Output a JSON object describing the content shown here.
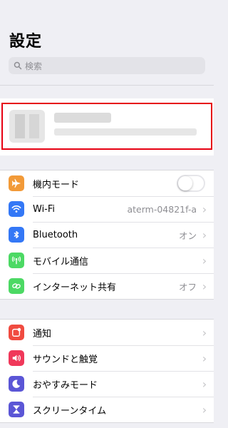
{
  "header": {
    "title": "設定"
  },
  "search": {
    "placeholder": "検索",
    "icon": "magnifying-glass-icon"
  },
  "profile": {
    "highlight_color": "#e60012"
  },
  "group1": {
    "items": [
      {
        "label": "機内モード",
        "icon": "airplane-icon",
        "color": "#f29a38",
        "toggle_on": false
      },
      {
        "label": "Wi-Fi",
        "value": "aterm-04821f-a",
        "icon": "wifi-icon",
        "color": "#3478f6"
      },
      {
        "label": "Bluetooth",
        "value": "オン",
        "icon": "bluetooth-icon",
        "color": "#3478f6"
      },
      {
        "label": "モバイル通信",
        "icon": "antenna-icon",
        "color": "#4cd964"
      },
      {
        "label": "インターネット共有",
        "value": "オフ",
        "icon": "link-icon",
        "color": "#4cd964"
      }
    ]
  },
  "group2": {
    "items": [
      {
        "label": "通知",
        "icon": "notifications-icon",
        "color": "#f04b40"
      },
      {
        "label": "サウンドと触覚",
        "icon": "speaker-icon",
        "color": "#f0385a"
      },
      {
        "label": "おやすみモード",
        "icon": "moon-icon",
        "color": "#5b56d6"
      },
      {
        "label": "スクリーンタイム",
        "icon": "hourglass-icon",
        "color": "#5b56d6"
      }
    ]
  }
}
